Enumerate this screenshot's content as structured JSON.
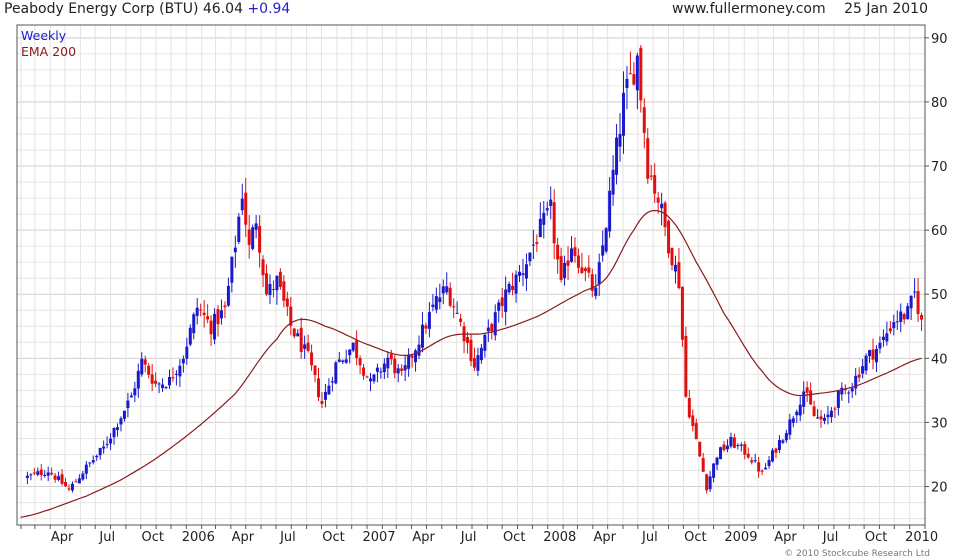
{
  "header": {
    "title": "Peabody Energy Corp (BTU)",
    "last": "46.04",
    "change": "+0.94",
    "site": "www.fullermoney.com",
    "date": "25 Jan 2010"
  },
  "legend": {
    "weekly": "Weekly",
    "ema": "EMA 200"
  },
  "copyright": "© 2010 Stockcube Research Ltd",
  "colors": {
    "up": "#1a1acc",
    "down": "#e01010",
    "ema": "#8b1a1a",
    "grid": "#d8d8d8",
    "axis": "#555555"
  },
  "chart_data": {
    "type": "candlestick",
    "title": "Peabody Energy Corp (BTU)",
    "timeframe": "Weekly",
    "x_tick_labels": [
      "Apr",
      "Jul",
      "Oct",
      "2006",
      "Apr",
      "Jul",
      "Oct",
      "2007",
      "Apr",
      "Jul",
      "Oct",
      "2008",
      "Apr",
      "Jul",
      "Oct",
      "2009",
      "Apr",
      "Jul",
      "Oct",
      "2010"
    ],
    "y_tick_labels": [
      20,
      30,
      40,
      50,
      60,
      70,
      80,
      90
    ],
    "ylim": [
      14,
      92
    ],
    "y_axis_side": "right",
    "grid": true,
    "price_anchors": [
      {
        "date": "2005-02-14",
        "close": 21.5
      },
      {
        "date": "2005-03-28",
        "close": 22.5
      },
      {
        "date": "2005-05-09",
        "close": 19.5
      },
      {
        "date": "2005-06-13",
        "close": 23.0
      },
      {
        "date": "2005-07-18",
        "close": 26.0
      },
      {
        "date": "2005-08-15",
        "close": 30.0
      },
      {
        "date": "2005-09-12",
        "close": 34.0
      },
      {
        "date": "2005-10-03",
        "close": 39.5
      },
      {
        "date": "2005-10-31",
        "close": 36.0
      },
      {
        "date": "2005-11-28",
        "close": 36.5
      },
      {
        "date": "2005-12-26",
        "close": 40.5
      },
      {
        "date": "2006-01-23",
        "close": 48.0
      },
      {
        "date": "2006-02-20",
        "close": 45.0
      },
      {
        "date": "2006-03-20",
        "close": 47.5
      },
      {
        "date": "2006-04-10",
        "close": 58.0
      },
      {
        "date": "2006-04-24",
        "close": 66.0
      },
      {
        "date": "2006-05-08",
        "close": 57.0
      },
      {
        "date": "2006-05-22",
        "close": 62.0
      },
      {
        "date": "2006-06-12",
        "close": 50.0
      },
      {
        "date": "2006-07-03",
        "close": 52.0
      },
      {
        "date": "2006-07-31",
        "close": 45.0
      },
      {
        "date": "2006-09-04",
        "close": 40.0
      },
      {
        "date": "2006-10-02",
        "close": 33.0
      },
      {
        "date": "2006-10-30",
        "close": 39.0
      },
      {
        "date": "2006-12-04",
        "close": 42.0
      },
      {
        "date": "2007-01-08",
        "close": 36.0
      },
      {
        "date": "2007-02-12",
        "close": 40.0
      },
      {
        "date": "2007-03-12",
        "close": 37.0
      },
      {
        "date": "2007-04-16",
        "close": 43.0
      },
      {
        "date": "2007-05-21",
        "close": 49.0
      },
      {
        "date": "2007-06-11",
        "close": 51.0
      },
      {
        "date": "2007-07-02",
        "close": 47.0
      },
      {
        "date": "2007-08-06",
        "close": 39.0
      },
      {
        "date": "2007-09-03",
        "close": 44.0
      },
      {
        "date": "2007-10-08",
        "close": 50.0
      },
      {
        "date": "2007-11-12",
        "close": 54.0
      },
      {
        "date": "2007-12-10",
        "close": 59.0
      },
      {
        "date": "2008-01-07",
        "close": 63.0
      },
      {
        "date": "2008-01-28",
        "close": 51.0
      },
      {
        "date": "2008-02-18",
        "close": 58.0
      },
      {
        "date": "2008-03-17",
        "close": 53.0
      },
      {
        "date": "2008-04-07",
        "close": 50.0
      },
      {
        "date": "2008-05-05",
        "close": 65.0
      },
      {
        "date": "2008-06-02",
        "close": 80.0
      },
      {
        "date": "2008-06-30",
        "close": 87.0
      },
      {
        "date": "2008-07-21",
        "close": 70.0
      },
      {
        "date": "2008-08-11",
        "close": 65.0
      },
      {
        "date": "2008-09-01",
        "close": 58.0
      },
      {
        "date": "2008-09-22",
        "close": 52.0
      },
      {
        "date": "2008-10-06",
        "close": 34.0
      },
      {
        "date": "2008-10-27",
        "close": 27.0
      },
      {
        "date": "2008-11-17",
        "close": 20.0
      },
      {
        "date": "2008-12-08",
        "close": 25.0
      },
      {
        "date": "2009-01-05",
        "close": 27.0
      },
      {
        "date": "2009-02-09",
        "close": 25.0
      },
      {
        "date": "2009-03-09",
        "close": 22.0
      },
      {
        "date": "2009-04-06",
        "close": 26.0
      },
      {
        "date": "2009-05-04",
        "close": 30.0
      },
      {
        "date": "2009-06-01",
        "close": 35.0
      },
      {
        "date": "2009-06-22",
        "close": 31.0
      },
      {
        "date": "2009-07-13",
        "close": 30.0
      },
      {
        "date": "2009-08-10",
        "close": 34.0
      },
      {
        "date": "2009-09-07",
        "close": 36.0
      },
      {
        "date": "2009-10-05",
        "close": 40.0
      },
      {
        "date": "2009-11-02",
        "close": 42.0
      },
      {
        "date": "2009-11-30",
        "close": 46.0
      },
      {
        "date": "2009-12-28",
        "close": 47.0
      },
      {
        "date": "2010-01-11",
        "close": 50.0
      },
      {
        "date": "2010-01-25",
        "close": 46.04
      }
    ],
    "ema_anchors": [
      {
        "date": "2005-01-31",
        "value": 15.2
      },
      {
        "date": "2005-06-13",
        "value": 18.5
      },
      {
        "date": "2005-09-12",
        "value": 22.0
      },
      {
        "date": "2005-12-26",
        "value": 27.5
      },
      {
        "date": "2006-04-10",
        "value": 34.5
      },
      {
        "date": "2006-07-03",
        "value": 43.0
      },
      {
        "date": "2006-08-14",
        "value": 46.0
      },
      {
        "date": "2006-10-09",
        "value": 45.0
      },
      {
        "date": "2007-01-08",
        "value": 42.0
      },
      {
        "date": "2007-03-26",
        "value": 40.5
      },
      {
        "date": "2007-06-18",
        "value": 43.5
      },
      {
        "date": "2007-09-03",
        "value": 44.0
      },
      {
        "date": "2007-12-10",
        "value": 46.5
      },
      {
        "date": "2008-03-03",
        "value": 50.0
      },
      {
        "date": "2008-04-28",
        "value": 52.5
      },
      {
        "date": "2008-06-23",
        "value": 60.0
      },
      {
        "date": "2008-07-28",
        "value": 63.0
      },
      {
        "date": "2008-09-08",
        "value": 61.5
      },
      {
        "date": "2008-10-27",
        "value": 55.0
      },
      {
        "date": "2008-12-22",
        "value": 47.0
      },
      {
        "date": "2009-03-09",
        "value": 38.0
      },
      {
        "date": "2009-05-04",
        "value": 34.5
      },
      {
        "date": "2009-06-29",
        "value": 34.5
      },
      {
        "date": "2009-09-07",
        "value": 35.5
      },
      {
        "date": "2009-11-09",
        "value": 37.5
      },
      {
        "date": "2010-01-25",
        "value": 40.0
      }
    ]
  }
}
